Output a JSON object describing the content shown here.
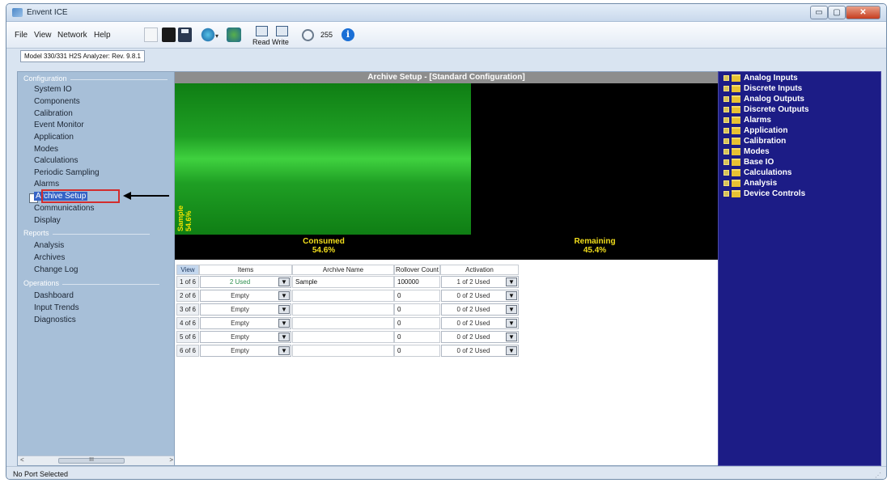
{
  "window": {
    "title": "Envent ICE",
    "minimize": "▭",
    "maximize": "▢",
    "close": "✕"
  },
  "menu": [
    "File",
    "View",
    "Network",
    "Help"
  ],
  "toolbar": {
    "read_label": "Read",
    "write_label": "Write",
    "count": "255",
    "info": "i"
  },
  "device_tab": "Model 330/331 H2S Analyzer: Rev. 9.8.1",
  "nav": {
    "configuration": {
      "header": "Configuration",
      "items": [
        "System IO",
        "Components",
        "Calibration",
        "Event Monitor",
        "Application",
        "Modes",
        "Calculations",
        "Periodic Sampling",
        "Alarms",
        "Archive Setup",
        "Communications",
        "Display"
      ]
    },
    "reports": {
      "header": "Reports",
      "items": [
        "Analysis",
        "Archives",
        "Change Log"
      ]
    },
    "operations": {
      "header": "Operations",
      "items": [
        "Dashboard",
        "Input Trends",
        "Diagnostics"
      ]
    },
    "selected": "Archive Setup",
    "scroll": {
      "left": "<",
      "right": ">",
      "thumb": "III"
    }
  },
  "content": {
    "title": "Archive Setup - [Standard Configuration]",
    "usage": {
      "fill_percent": 54.6,
      "series_label": "Sample",
      "series_value": "54.6%",
      "consumed_label": "Consumed",
      "consumed_value": "54.6%",
      "remaining_label": "Remaining",
      "remaining_value": "45.4%"
    },
    "table": {
      "headers": {
        "view": "View",
        "items": "Items",
        "name": "Archive Name",
        "rollover": "Rollover Count",
        "activation": "Activation"
      },
      "rows": [
        {
          "view": "1 of 6",
          "items": "2 Used",
          "name": "Sample",
          "rollover": "100000",
          "activation": "1 of 2 Used"
        },
        {
          "view": "2 of 6",
          "items": "Empty",
          "name": "",
          "rollover": "0",
          "activation": "0 of 2 Used"
        },
        {
          "view": "3 of 6",
          "items": "Empty",
          "name": "",
          "rollover": "0",
          "activation": "0 of 2 Used"
        },
        {
          "view": "4 of 6",
          "items": "Empty",
          "name": "",
          "rollover": "0",
          "activation": "0 of 2 Used"
        },
        {
          "view": "5 of 6",
          "items": "Empty",
          "name": "",
          "rollover": "0",
          "activation": "0 of 2 Used"
        },
        {
          "view": "6 of 6",
          "items": "Empty",
          "name": "",
          "rollover": "0",
          "activation": "0 of 2 Used"
        }
      ],
      "dropdown_glyph": "▼"
    }
  },
  "tree": [
    "Analog Inputs",
    "Discrete Inputs",
    "Analog Outputs",
    "Discrete Outputs",
    "Alarms",
    "Application",
    "Calibration",
    "Modes",
    "Base IO",
    "Calculations",
    "Analysis",
    "Device Controls"
  ],
  "status": {
    "text": "No Port Selected",
    "grip": "⋰"
  },
  "colors": {
    "accent": "#3563c6",
    "tree_bg": "#1c1c86",
    "usage_green": "#1f9f24",
    "usage_text": "#f2de1c",
    "highlight": "#d32d2d"
  }
}
